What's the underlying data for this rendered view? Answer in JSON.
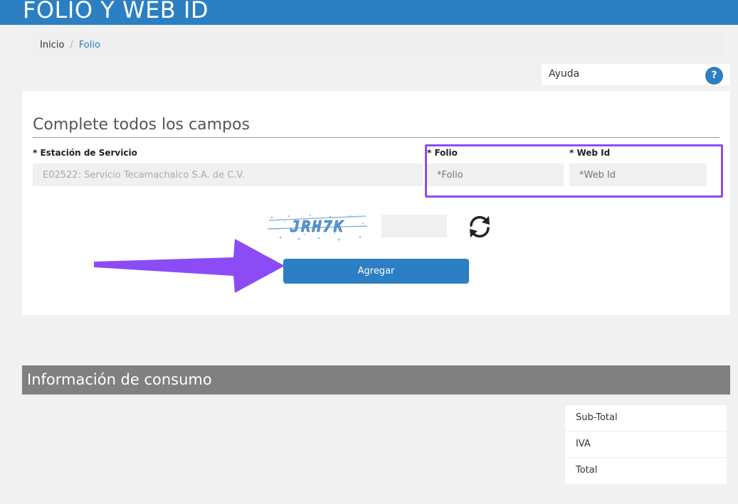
{
  "header": {
    "title": "FOLIO Y WEB ID"
  },
  "breadcrumb": {
    "home": "Inicio",
    "separator": "/",
    "current": "Folio"
  },
  "help": {
    "label": "Ayuda",
    "icon_glyph": "?"
  },
  "form": {
    "heading": "Complete todos los campos",
    "station_label": "* Estación de Servicio",
    "station_value": "E02522: Servicio Tecamachalco S.A. de C.V.",
    "folio_label": "* Folio",
    "folio_placeholder": "*Folio",
    "webid_label": "* Web Id",
    "webid_placeholder": "*Web Id",
    "captcha_text": "JRH7K",
    "captcha_input_value": "",
    "submit_label": "Agregar"
  },
  "consumo": {
    "title": "Información de consumo",
    "rows": [
      "Sub-Total",
      "IVA",
      "Total"
    ]
  },
  "colors": {
    "primary": "#2b7fc2",
    "highlight": "#8b4cf5",
    "section_head": "#808080"
  },
  "icons": {
    "refresh": "refresh-icon",
    "help": "question-icon",
    "annotation": "arrow-annotation"
  }
}
